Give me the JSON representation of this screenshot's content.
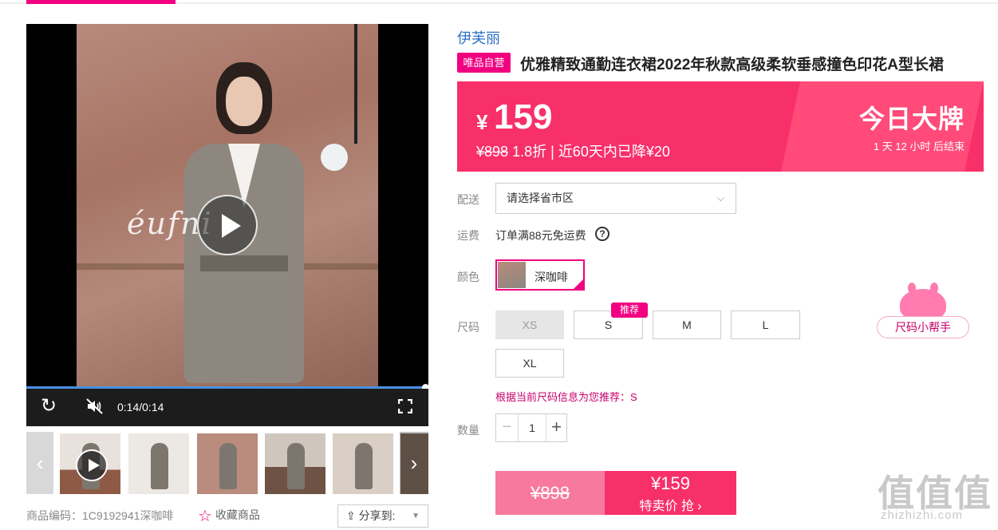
{
  "video": {
    "brand_script": "éufni",
    "time": "0:14/0:14"
  },
  "meta": {
    "sku_label": "商品编码：",
    "sku_value": "1C9192941深咖啡",
    "favorite_label": "收藏商品",
    "share_label": "分享到:"
  },
  "product": {
    "brand": "伊芙丽",
    "self_badge": "唯品自营",
    "title": "优雅精致通勤连衣裙2022年秋款高级柔软垂感撞色印花A型长裙"
  },
  "price": {
    "currency": "¥",
    "current": "159",
    "original": "¥898",
    "discount": "1.8折",
    "separator": "|",
    "drop_note": "近60天内已降¥20",
    "promo_title": "今日大牌",
    "countdown": "1  天  12  小时  后结束"
  },
  "delivery": {
    "label": "配送",
    "placeholder": "请选择省市区"
  },
  "shipping": {
    "label": "运费",
    "text": "订单满88元免运费",
    "help": "?"
  },
  "color": {
    "label": "颜色",
    "selected": "深咖啡"
  },
  "size": {
    "label": "尺码",
    "options": [
      "XS",
      "S",
      "M",
      "L",
      "XL"
    ],
    "recommended_badge": "推荐",
    "tip": "根据当前尺码信息为您推荐：S",
    "helper": "尺码小帮手"
  },
  "quantity": {
    "label": "数量",
    "value": "1",
    "minus": "−",
    "plus": "+"
  },
  "buy": {
    "original": "¥898",
    "price": "¥159",
    "action": "特卖价 抢 ›"
  },
  "watermark": {
    "main": "值值值",
    "sub": "zhizhizhi.com"
  },
  "colors": {
    "accent": "#f10180",
    "price_banner": "#f7306a",
    "brand_link": "#2b6fc7"
  }
}
